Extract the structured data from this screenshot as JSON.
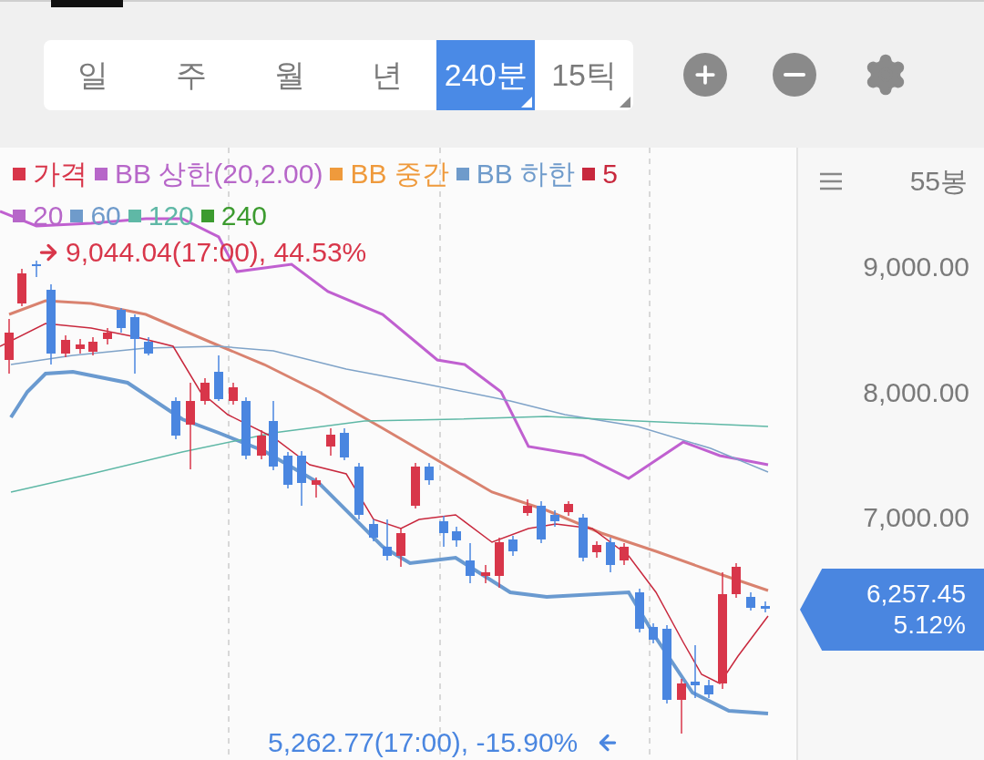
{
  "period_tabs": [
    {
      "label": "일",
      "selected": false,
      "dropdown": false
    },
    {
      "label": "주",
      "selected": false,
      "dropdown": false
    },
    {
      "label": "월",
      "selected": false,
      "dropdown": false
    },
    {
      "label": "년",
      "selected": false,
      "dropdown": false
    },
    {
      "label": "240분",
      "selected": true,
      "dropdown": true
    },
    {
      "label": "15틱",
      "selected": false,
      "dropdown": true
    }
  ],
  "legend": [
    {
      "label": "가격",
      "color": "#d8364a"
    },
    {
      "label": "BB 상한(20,2.00)",
      "color": "#b767c9"
    },
    {
      "label": "BB 중간",
      "color": "#ef9a3c"
    },
    {
      "label": "BB 하한",
      "color": "#6f9bcb"
    },
    {
      "label": "5",
      "color": "#c8283d"
    },
    {
      "label": "20",
      "color": "#b767c9"
    },
    {
      "label": "60",
      "color": "#6f9bcb"
    },
    {
      "label": "120",
      "color": "#5fb8a6"
    },
    {
      "label": "240",
      "color": "#3c9b2f"
    }
  ],
  "high_marker": "9,044.04(17:00), 44.53%",
  "low_marker": "5,262.77(17:00), -15.90%",
  "candle_count": "55봉",
  "y_axis_labels": [
    "9,000.00",
    "8,000.00",
    "7,000.00"
  ],
  "price_badge": {
    "price": "6,257.45",
    "change": "5.12%"
  }
}
